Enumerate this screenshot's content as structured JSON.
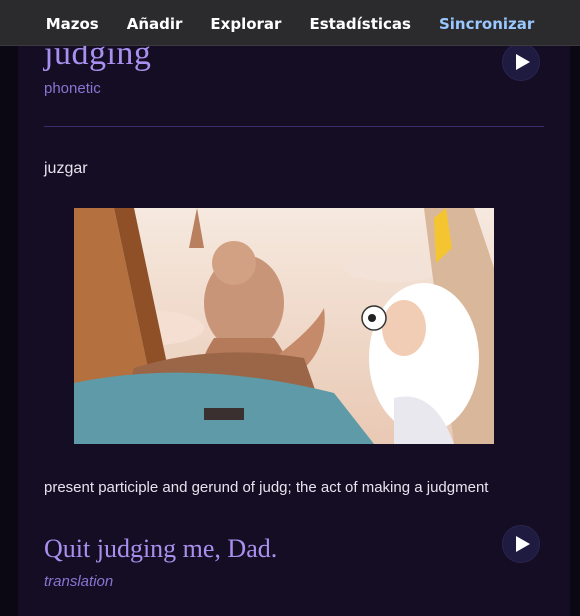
{
  "nav": {
    "items": [
      {
        "label": "Mazos"
      },
      {
        "label": "Añadir"
      },
      {
        "label": "Explorar"
      },
      {
        "label": "Estadísticas"
      },
      {
        "label": "Sincronizar"
      }
    ],
    "active_color": "#9ac8ff"
  },
  "card": {
    "word": "judging",
    "phonetic": "phonetic",
    "translation": "juzgar",
    "definition": "present participle and gerund of judg; the act of making a judgment",
    "example": "Quit judging me, Dad.",
    "example_label": "translation",
    "play_icon": "play-icon",
    "accent_color": "#a98fee"
  }
}
